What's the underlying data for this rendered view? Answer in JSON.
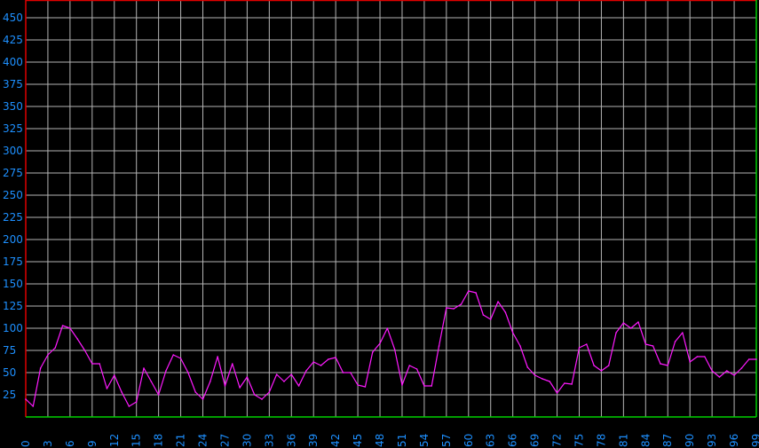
{
  "chart_data": {
    "type": "line",
    "title": "",
    "xlabel": "",
    "ylabel": "",
    "xlim": [
      0,
      99
    ],
    "ylim": [
      0,
      470
    ],
    "grid": true,
    "y_ticks": [
      25,
      50,
      75,
      100,
      125,
      150,
      175,
      200,
      225,
      250,
      275,
      300,
      325,
      350,
      375,
      400,
      425,
      450
    ],
    "x_ticks": [
      0,
      3,
      6,
      9,
      12,
      15,
      18,
      21,
      24,
      27,
      30,
      33,
      36,
      39,
      42,
      45,
      48,
      51,
      54,
      57,
      60,
      63,
      66,
      69,
      72,
      75,
      78,
      81,
      84,
      87,
      90,
      93,
      96,
      99
    ],
    "series": [
      {
        "values": [
          20,
          12,
          55,
          70,
          78,
          103,
          100,
          88,
          75,
          60,
          60,
          32,
          47,
          28,
          12,
          17,
          55,
          40,
          25,
          52,
          70,
          66,
          50,
          28,
          20,
          40,
          68,
          35,
          60,
          33,
          45,
          25,
          20,
          28,
          48,
          40,
          48,
          35,
          52,
          62,
          58,
          65,
          67,
          50,
          50,
          36,
          34,
          73,
          83,
          100,
          76,
          36,
          58,
          54,
          35,
          35,
          80,
          123,
          122,
          127,
          142,
          140,
          115,
          110,
          130,
          118,
          95,
          80,
          56,
          47,
          43,
          40,
          27,
          38,
          37,
          78,
          82,
          58,
          52,
          58,
          95,
          106,
          100,
          107,
          82,
          80,
          60,
          58,
          85,
          95,
          62,
          68,
          68,
          52,
          45,
          52,
          47,
          55,
          65,
          65
        ]
      }
    ],
    "colors": {
      "background": "#000000",
      "grid": "#b4b4b4",
      "line": "#ff1aff",
      "ticks": "#1e90ff",
      "top_border": "#e00000",
      "baseline": "#00d000"
    }
  }
}
